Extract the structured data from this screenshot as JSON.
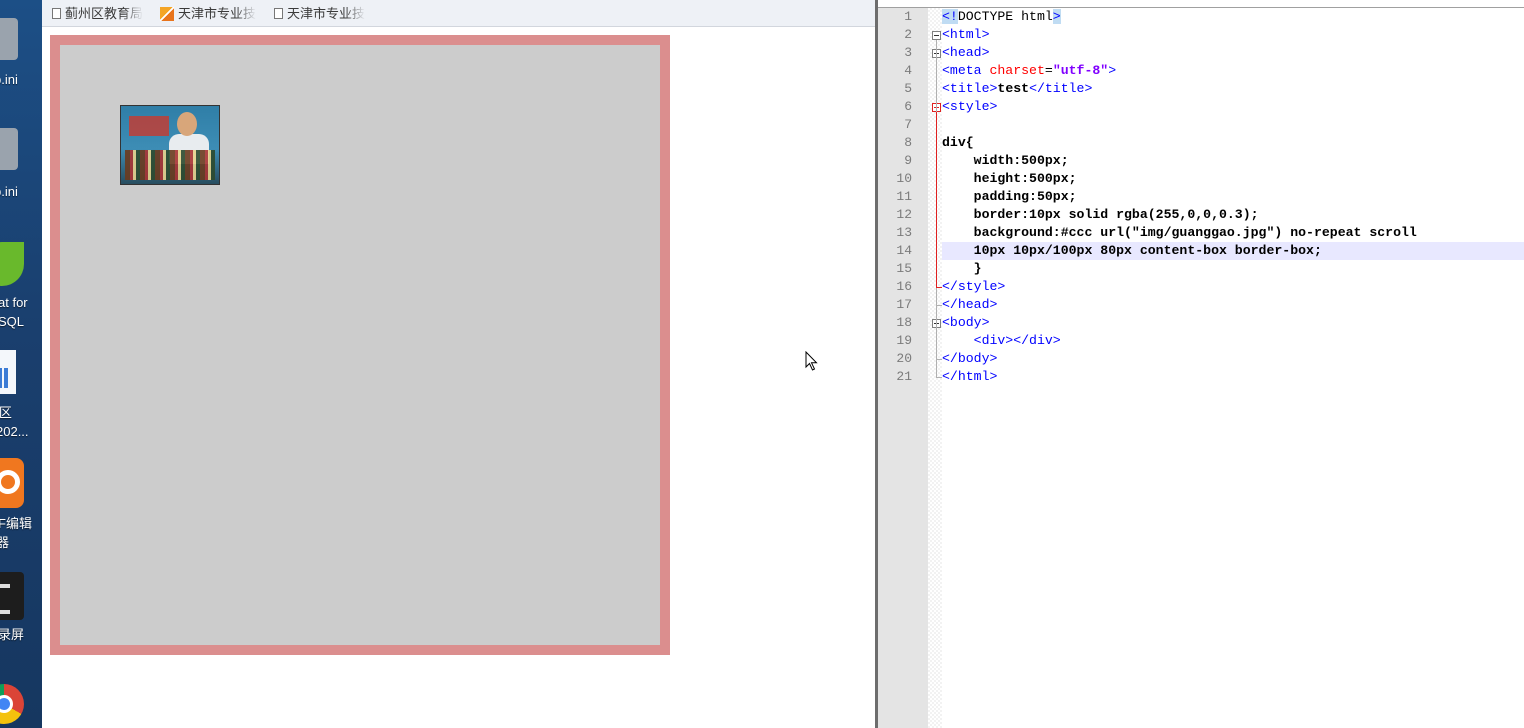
{
  "desktop": {
    "icons": [
      {
        "name": "ini-file-1",
        "label": "p.ini",
        "icon": "file-icon"
      },
      {
        "name": "ini-file-2",
        "label": "p.ini",
        "icon": "file-icon"
      },
      {
        "name": "navicat",
        "label_lines": [
          "at for",
          "SQL"
        ],
        "icon": "navicat-icon"
      },
      {
        "name": "district-doc",
        "label_lines": [
          "l区",
          "202..."
        ],
        "icon": "document-icon"
      },
      {
        "name": "pdf-editor",
        "label_lines": [
          "F编辑",
          "器"
        ],
        "icon": "pdf-editor-icon"
      },
      {
        "name": "screen-recorder",
        "label": "录屏",
        "icon": "recorder-icon"
      },
      {
        "name": "chrome",
        "label": "",
        "icon": "chrome-icon"
      }
    ]
  },
  "browser": {
    "bookmarks": [
      {
        "label": "蓟州区教育局",
        "icon": "page-icon"
      },
      {
        "label": "天津市专业技",
        "icon": "site-logo-icon"
      },
      {
        "label": "天津市专业技",
        "icon": "page-icon"
      }
    ],
    "demo": {
      "box_background": "#ccc",
      "box_border_color": "rgba(255,0,0,0.3)",
      "image": "guanggao-poster-image"
    }
  },
  "editor": {
    "lines": [
      {
        "n": "1",
        "tokens": [
          [
            "sel tag",
            "<!"
          ],
          [
            "",
            "DOCTYPE html"
          ],
          [
            "sel tag",
            ">"
          ]
        ]
      },
      {
        "n": "2",
        "tokens": [
          [
            "tag",
            "<html>"
          ]
        ]
      },
      {
        "n": "3",
        "tokens": [
          [
            "tag",
            "<head>"
          ]
        ]
      },
      {
        "n": "4",
        "tokens": [
          [
            "tag",
            "<meta "
          ],
          [
            "attr",
            "charset"
          ],
          [
            "",
            "="
          ],
          [
            "str",
            "\"utf-8\""
          ],
          [
            "tag",
            ">"
          ]
        ]
      },
      {
        "n": "5",
        "tokens": [
          [
            "tag",
            "<title>"
          ],
          [
            "bold",
            "test"
          ],
          [
            "tag",
            "</title>"
          ]
        ]
      },
      {
        "n": "6",
        "tokens": [
          [
            "tag",
            "<style>"
          ]
        ]
      },
      {
        "n": "7",
        "tokens": []
      },
      {
        "n": "8",
        "tokens": [
          [
            "bold",
            "div{"
          ]
        ]
      },
      {
        "n": "9",
        "tokens": [
          [
            "bold",
            "    width:500px;"
          ]
        ]
      },
      {
        "n": "10",
        "tokens": [
          [
            "bold",
            "    height:500px;"
          ]
        ]
      },
      {
        "n": "11",
        "tokens": [
          [
            "bold",
            "    padding:50px;"
          ]
        ]
      },
      {
        "n": "12",
        "tokens": [
          [
            "bold",
            "    border:10px solid rgba(255,0,0,0.3);"
          ]
        ]
      },
      {
        "n": "13",
        "tokens": [
          [
            "bold",
            "    background:#ccc url(\"img/guanggao.jpg\") no-repeat scroll"
          ]
        ]
      },
      {
        "n": "14",
        "tokens": [
          [
            "bold",
            "    10px 10px/100px 80px content-box border-box;"
          ]
        ]
      },
      {
        "n": "15",
        "tokens": [
          [
            "bold",
            "    }"
          ]
        ]
      },
      {
        "n": "16",
        "tokens": [
          [
            "tag",
            "</style>"
          ]
        ]
      },
      {
        "n": "17",
        "tokens": [
          [
            "tag",
            "</head>"
          ]
        ]
      },
      {
        "n": "18",
        "tokens": [
          [
            "tag",
            "<body>"
          ]
        ]
      },
      {
        "n": "19",
        "tokens": [
          [
            "",
            "    "
          ],
          [
            "tag",
            "<div></div>"
          ]
        ]
      },
      {
        "n": "20",
        "tokens": [
          [
            "tag",
            "</body>"
          ]
        ]
      },
      {
        "n": "21",
        "tokens": [
          [
            "tag",
            "</html>"
          ]
        ]
      }
    ],
    "current_line": "14",
    "colors": {
      "tag": "#0000ff",
      "attr": "#ff0000",
      "string": "#8000ff",
      "fold_active": "#e02020"
    }
  }
}
